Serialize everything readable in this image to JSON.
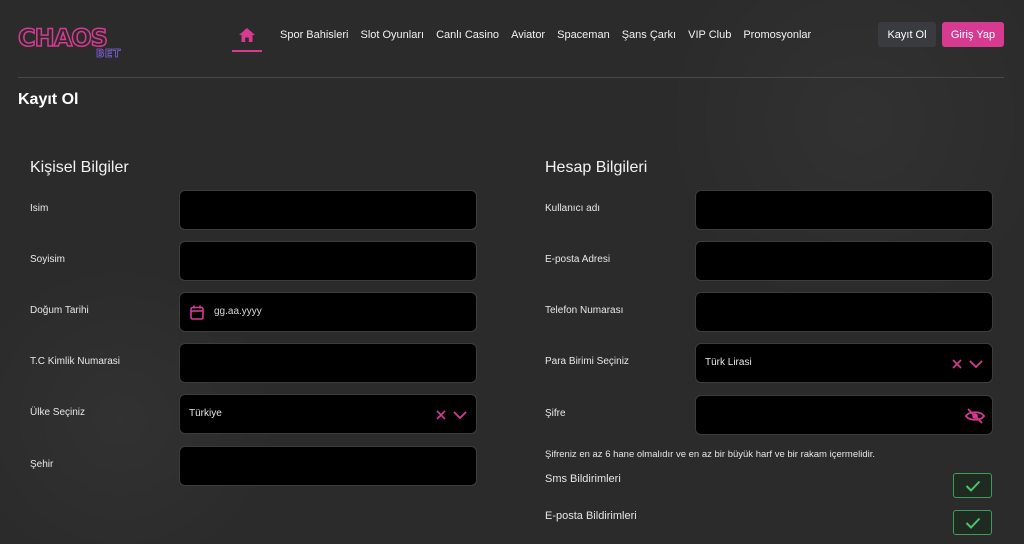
{
  "header": {
    "logo_text": "CHAOS",
    "logo_sub": "BET",
    "nav": [
      "Spor Bahisleri",
      "Slot Oyunları",
      "Canlı Casino",
      "Aviator",
      "Spaceman",
      "Şans Çarkı",
      "VIP Club",
      "Promosyonlar"
    ],
    "register_label": "Kayıt Ol",
    "login_label": "Giriş Yap"
  },
  "page_title": "Kayıt Ol",
  "personal": {
    "title": "Kişisel Bilgiler",
    "name_label": "Isim",
    "surname_label": "Soyisim",
    "birthdate_label": "Doğum Tarihi",
    "birthdate_placeholder": "gg.aa.yyyy",
    "tc_label": "T.C Kimlik Numarasi",
    "country_label": "Ülke Seçiniz",
    "country_value": "Türkiye",
    "city_label": "Şehir"
  },
  "account": {
    "title": "Hesap Bilgileri",
    "username_label": "Kullanıcı adı",
    "email_label": "E-posta Adresi",
    "phone_label": "Telefon Numarası",
    "currency_label": "Para Birimi Seçiniz",
    "currency_value": "Türk Lirasi",
    "password_label": "Şifre",
    "password_hint": "Şifreniz en az 6 hane olmalıdır ve en az bir büyük harf ve bir rakam içermelidir.",
    "sms_label": "Sms Bildirimleri",
    "email_notify_label": "E-posta Bildirimleri",
    "sms_checked": true,
    "email_checked": true
  },
  "colors": {
    "accent": "#d63a91",
    "check": "#3e9c57"
  }
}
